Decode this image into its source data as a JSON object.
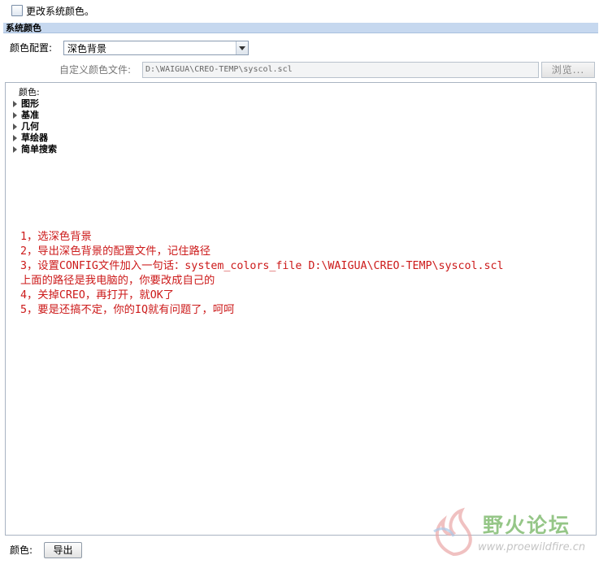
{
  "header": {
    "change_system_colors_label": "更改系统颜色。",
    "checkbox_icon": "checkbox-icon"
  },
  "section": {
    "title": "系统颜色"
  },
  "color_config": {
    "label": "颜色配置:",
    "selected": "深色背景",
    "dropdown_icon": "chevron-down-icon"
  },
  "custom_file": {
    "label": "自定义颜色文件:",
    "value": "D:\\WAIGUA\\CREO-TEMP\\syscol.scl",
    "browse_label": "浏览..."
  },
  "tree": {
    "root_label": "颜色:",
    "items": [
      {
        "label": "图形"
      },
      {
        "label": "基准"
      },
      {
        "label": "几何"
      },
      {
        "label": "草绘器"
      },
      {
        "label": "简单搜索"
      }
    ]
  },
  "annotation": {
    "lines": [
      "1，选深色背景",
      "2，导出深色背景的配置文件，记住路径",
      "3，设置CONFIG文件加入一句话：system_colors_file D:\\WAIGUA\\CREO-TEMP\\syscol.scl",
      "上面的路径是我电脑的，你要改成自己的",
      "4，关掉CREO，再打开，就OK了",
      "5，要是还搞不定，你的IQ就有问题了，呵呵"
    ],
    "color": "#cc1a1a"
  },
  "watermark": {
    "title": "野火论坛",
    "url": "www.proewildfire.cn"
  },
  "footer": {
    "color_label": "颜色:",
    "export_label": "导出"
  },
  "colors": {
    "section_header_bg": "#c6d8ef",
    "annotation_text": "#cc1a1a"
  }
}
